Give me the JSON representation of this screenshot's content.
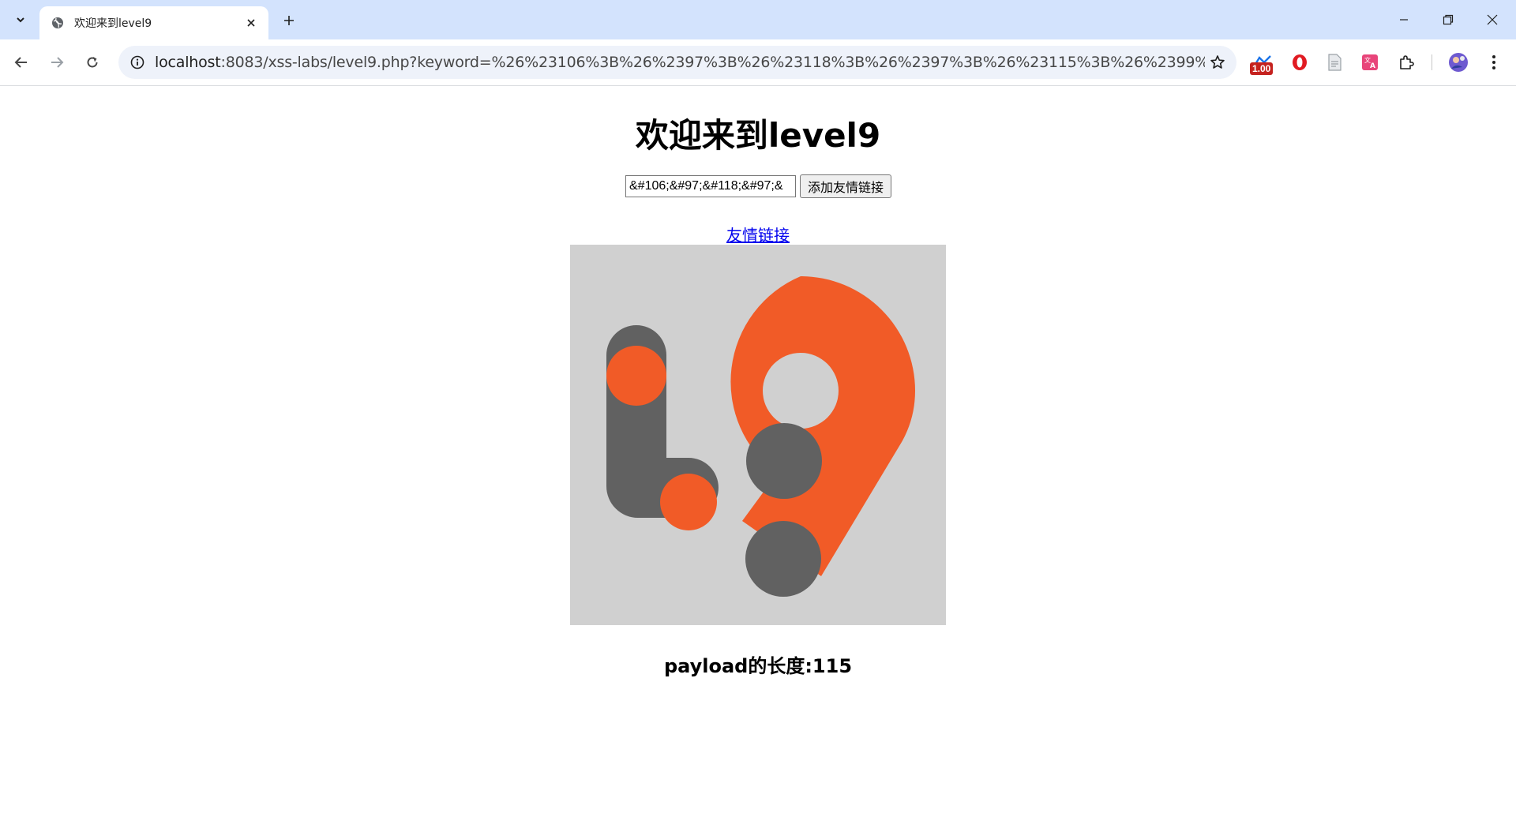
{
  "browser": {
    "tab_title": "欢迎来到level9",
    "url_host": "localhost",
    "url_rest": ":8083/xss-labs/level9.php?keyword=%26%23106%3B%26%2397%3B%26%23118%3B%26%2397%3B%26%23115%3B%26%2399%3B%26%23114...",
    "extension_badge": "1.00"
  },
  "page": {
    "title": "欢迎来到level9",
    "keyword_value": "&#106;&#97;&#118;&#97;&",
    "submit_label": "添加友情链接",
    "friend_link_text": "友情链接",
    "payload_text": "payload的长度:115"
  },
  "colors": {
    "logo_orange": "#f15b27",
    "logo_gray": "#616161",
    "logo_bg": "#d0d0d0"
  }
}
